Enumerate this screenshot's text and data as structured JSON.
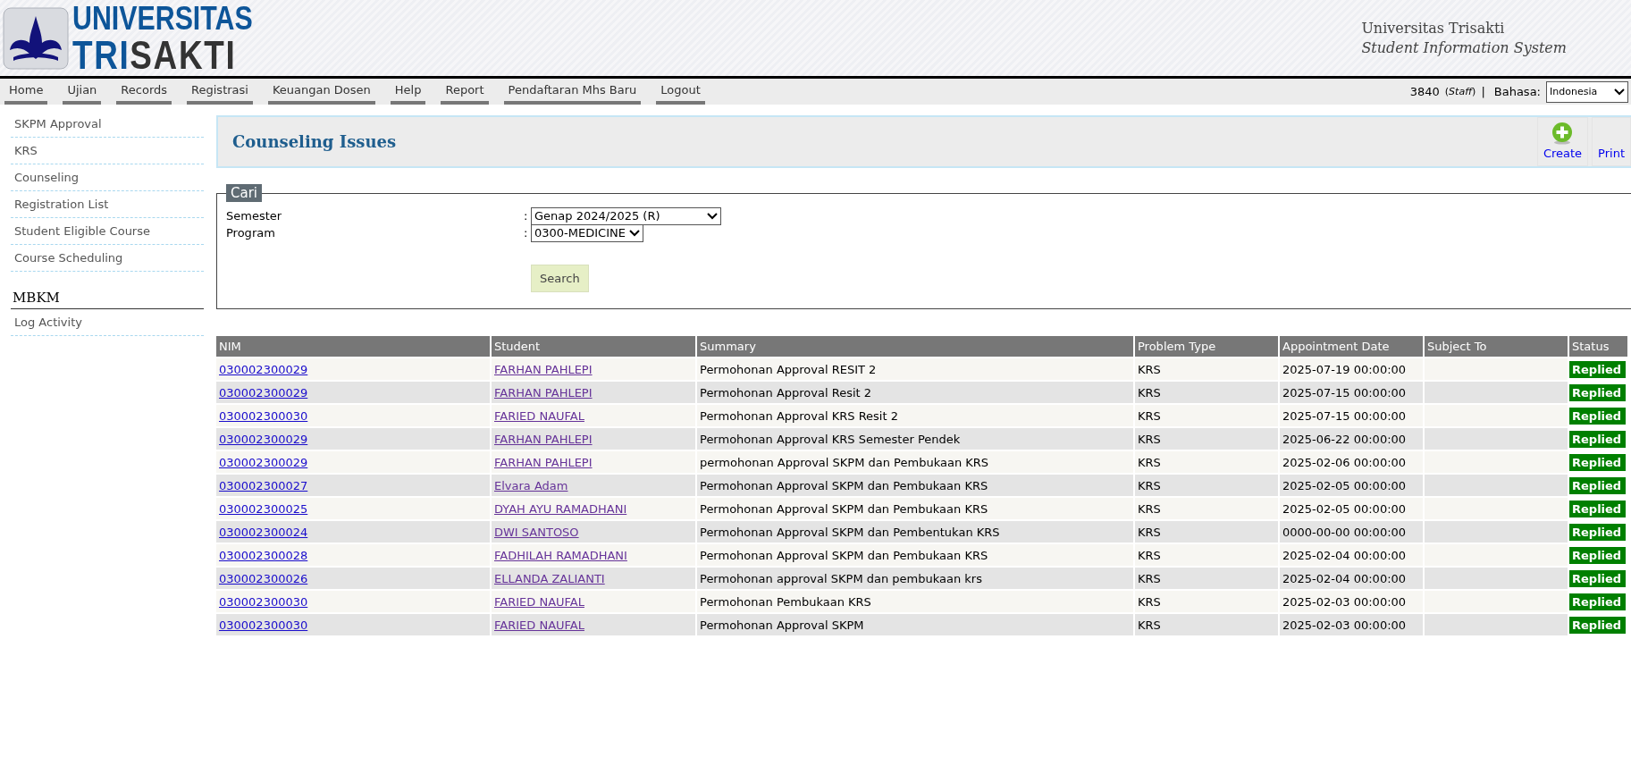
{
  "header": {
    "logo_line1": "UNIVERSITAS",
    "logo_line2": "TRI**SAKTI**",
    "site_name": "Universitas Trisakti",
    "site_subtitle": "Student Information System"
  },
  "nav": {
    "items": [
      "Home",
      "Ujian",
      "Records",
      "Registrasi",
      "Keuangan Dosen",
      "Help",
      "Report",
      "Pendaftaran Mhs Baru",
      "Logout"
    ],
    "user": "3840",
    "role": "(*Staff*)",
    "separator": "|",
    "language_label": "Bahasa:",
    "language": "Indonesia"
  },
  "sidebar": {
    "items": [
      "SKPM Approval",
      "KRS",
      "Counseling",
      "Registration List",
      "Student Eligible Course",
      "Course Scheduling"
    ],
    "sections": [
      {
        "title": "MBKM",
        "items": [
          "Log Activity"
        ]
      }
    ]
  },
  "page": {
    "title": "Counseling Issues",
    "actions": [
      {
        "kind": "create",
        "label": "Create"
      },
      {
        "kind": "print",
        "label": "Print"
      }
    ]
  },
  "search": {
    "legend": "Cari",
    "fields": [
      {
        "label": "Semester",
        "separator": ":",
        "value": "Genap 2024/2025 (R)",
        "wide": true
      },
      {
        "label": "Program",
        "separator": ":",
        "value": "0300-MEDICINE",
        "wide": false
      }
    ],
    "button": "Search"
  },
  "table": {
    "columns": [
      "NIM",
      "Student",
      "Summary",
      "Problem Type",
      "Appointment Date",
      "Subject To",
      "Status"
    ],
    "rows": [
      {
        "nim": "030002300029",
        "student": "FARHAN PAHLEPI",
        "summary": "Permohonan Approval RESIT 2",
        "problem_type": "KRS",
        "appointment_date": "2025-07-19 00:00:00",
        "status": "Replied"
      },
      {
        "nim": "030002300029",
        "student": "FARHAN PAHLEPI",
        "summary": "Permohonan Approval Resit 2",
        "problem_type": "KRS",
        "appointment_date": "2025-07-15 00:00:00",
        "status": "Replied"
      },
      {
        "nim": "030002300030",
        "student": "FARIED NAUFAL",
        "summary": "Permohonan Approval KRS Resit 2",
        "problem_type": "KRS",
        "appointment_date": "2025-07-15 00:00:00",
        "status": "Replied"
      },
      {
        "nim": "030002300029",
        "student": "FARHAN PAHLEPI",
        "summary": "Permohonan Approval KRS Semester Pendek",
        "problem_type": "KRS",
        "appointment_date": "2025-06-22 00:00:00",
        "status": "Replied"
      },
      {
        "nim": "030002300029",
        "student": "FARHAN PAHLEPI",
        "summary": "permohonan Approval SKPM dan Pembukaan KRS",
        "problem_type": "KRS",
        "appointment_date": "2025-02-06 00:00:00",
        "status": "Replied"
      },
      {
        "nim": "030002300027",
        "student": "Elvara Adam",
        "summary": "Permohonan Approval SKPM dan Pembukaan KRS",
        "problem_type": "KRS",
        "appointment_date": "2025-02-05 00:00:00",
        "status": "Replied"
      },
      {
        "nim": "030002300025",
        "student": "DYAH AYU RAMADHANI",
        "summary": "Permohonan Approval SKPM dan Pembukaan KRS",
        "problem_type": "KRS",
        "appointment_date": "2025-02-05 00:00:00",
        "status": "Replied"
      },
      {
        "nim": "030002300024",
        "student": "DWI SANTOSO",
        "summary": "Permohonan Approval SKPM dan Pembentukan KRS",
        "problem_type": "KRS",
        "appointment_date": "0000-00-00 00:00:00",
        "status": "Replied"
      },
      {
        "nim": "030002300028",
        "student": "FADHILAH RAMADHANI",
        "summary": "Permohonan Approval SKPM dan Pembukaan KRS",
        "problem_type": "KRS",
        "appointment_date": "2025-02-04 00:00:00",
        "status": "Replied"
      },
      {
        "nim": "030002300026",
        "student": "ELLANDA ZALIANTI",
        "summary": "Permohonan approval SKPM dan pembukaan krs",
        "problem_type": "KRS",
        "appointment_date": "2025-02-04 00:00:00",
        "status": "Replied"
      },
      {
        "nim": "030002300030",
        "student": "FARIED NAUFAL",
        "summary": "Permohonan Pembukaan KRS",
        "problem_type": "KRS",
        "appointment_date": "2025-02-03 00:00:00",
        "status": "Replied"
      },
      {
        "nim": "030002300030",
        "student": "FARIED NAUFAL",
        "summary": "Permohonan Approval SKPM",
        "problem_type": "KRS",
        "appointment_date": "2025-02-03 00:00:00",
        "status": "Replied"
      }
    ]
  }
}
